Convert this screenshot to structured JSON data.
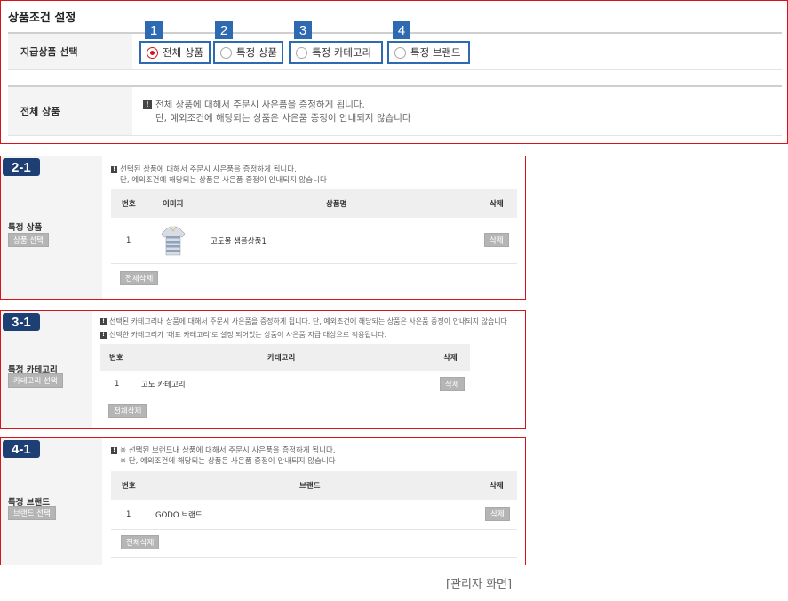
{
  "top": {
    "title": "상품조건 설정",
    "row1_label": "지급상품 선택",
    "row2_label": "전체 상품",
    "options": [
      {
        "num": "1",
        "label": "전체 상품",
        "checked": true
      },
      {
        "num": "2",
        "label": "특정 상품",
        "checked": false
      },
      {
        "num": "3",
        "label": "특정 카테고리",
        "checked": false
      },
      {
        "num": "4",
        "label": "특정 브랜드",
        "checked": false
      }
    ],
    "notice_line1": "전체 상품에 대해서 주문시 사은품을 증정하게 됩니다.",
    "notice_line2": "단, 예외조건에 해당되는 상품은 사은품 증정이 안내되지 않습니다",
    "warn_glyph": "!"
  },
  "product": {
    "badge": "2-1",
    "label": "특정 상품",
    "select_button": "상품 선택",
    "notice_line1": "선택된 상품에 대해서 주문시 사은품을 증정하게 됩니다.",
    "notice_line2": "단, 예외조건에 해당되는 상품은 사은품 증정이 안내되지 않습니다",
    "headers": {
      "num": "번호",
      "image": "이미지",
      "name": "상품명",
      "delete": "삭제"
    },
    "rows": [
      {
        "num": "1",
        "name": "고도몰 샘플상품1",
        "delete": "삭제"
      }
    ],
    "delete_all": "전체삭제"
  },
  "category": {
    "badge": "3-1",
    "label": "특정 카테고리",
    "select_button": "카테고리 선택",
    "notice_line1": "선택된 카테고리내 상품에 대해서 주문시 사은품을 증정하게 됩니다. 단, 예외조건에 해당되는 상품은 사은품 증정이 안내되지 않습니다",
    "notice_line2": "선택한 카테고리가 '대표 카테고리'로 설정 되어있는 상품이 사은품 지급 대상으로 적용됩니다.",
    "headers": {
      "num": "번호",
      "category": "카테고리",
      "delete": "삭제"
    },
    "rows": [
      {
        "num": "1",
        "name": "고도 카테고리",
        "delete": "삭제"
      }
    ],
    "delete_all": "전체삭제"
  },
  "brand": {
    "badge": "4-1",
    "label": "특정 브랜드",
    "select_button": "브랜드 선택",
    "notice_line1": "※ 선택된 브랜드내 상품에 대해서 주문시 사은품을 증정하게 됩니다.",
    "notice_line2": "※ 단, 예외조건에 해당되는 상품은 사은품 증정이 안내되지 않습니다",
    "headers": {
      "num": "번호",
      "brand": "브랜드",
      "delete": "삭제"
    },
    "rows": [
      {
        "num": "1",
        "name": "GODO 브랜드",
        "delete": "삭제"
      }
    ],
    "delete_all": "전체삭제"
  },
  "caption": "[관리자 화면]",
  "colors": {
    "highlight_border": "#d7141a",
    "badge_blue": "#2e6ab2",
    "badge_navy": "#1e3f73"
  }
}
